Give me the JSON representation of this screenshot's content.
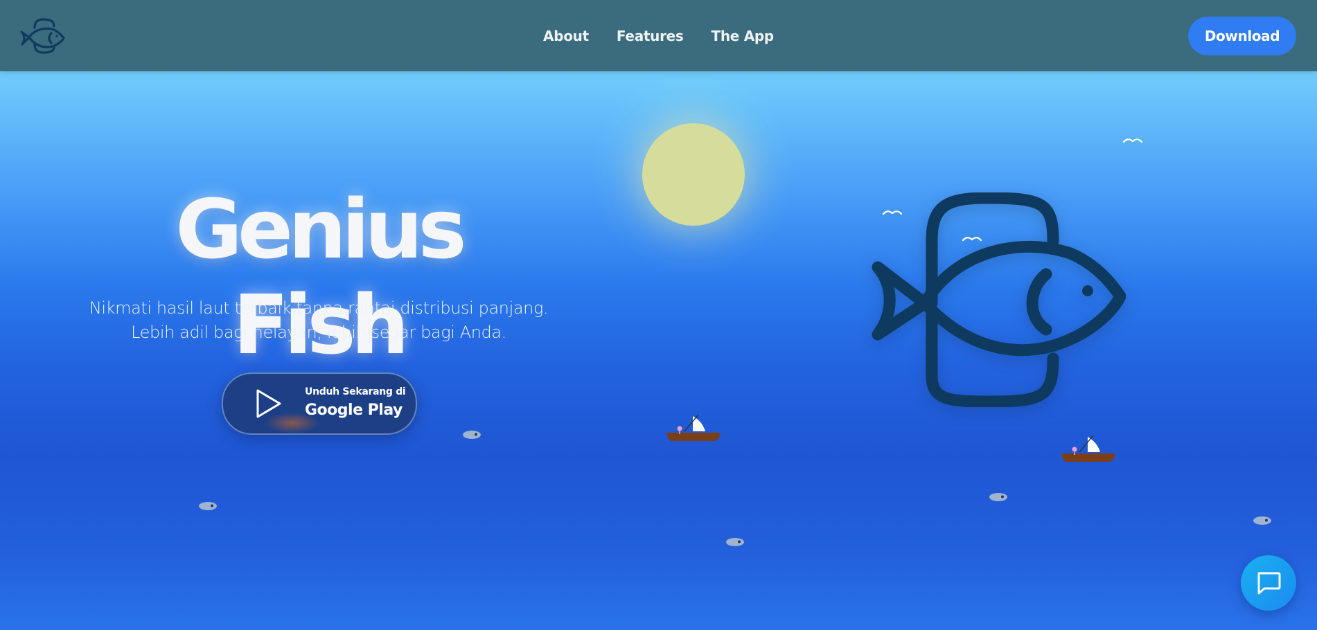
{
  "header": {
    "logo_icon": "fish-logo-icon",
    "nav": [
      {
        "label": "About"
      },
      {
        "label": "Features"
      },
      {
        "label": "The App"
      }
    ],
    "download_label": "Download"
  },
  "hero": {
    "title": "Genius Fish",
    "subtitle_line1": "Nikmati hasil laut terbaik tanpa rantai distribusi panjang.",
    "subtitle_line2": "Lebih adil bagi nelayan, lebih segar bagi Anda.",
    "store_button": {
      "small": "Unduh Sekarang di",
      "big": "Google Play",
      "icon": "play-triangle-icon"
    }
  },
  "scene": {
    "sun_color": "#d6dc9c",
    "big_fish_icon": "fish-logo-icon",
    "fish_color": "#0f3a5f"
  },
  "colors": {
    "header_bg": "#3b6c7d",
    "accent": "#2f7cf3",
    "play_button_bg": "#1d3f86"
  },
  "chat": {
    "icon": "chat-bubble-icon"
  }
}
